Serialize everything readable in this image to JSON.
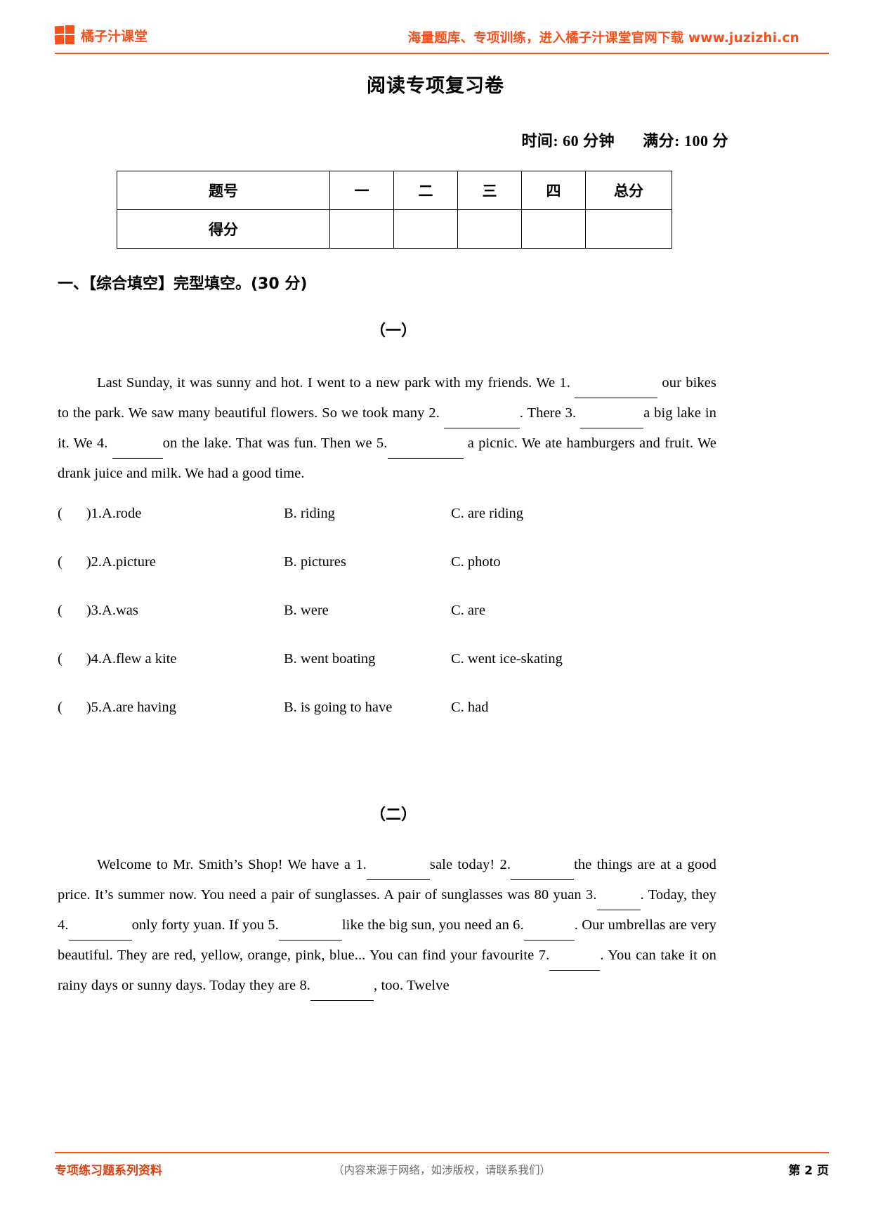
{
  "header": {
    "logo_text": "橘子汁课堂",
    "logo_icon": "four-squares-logo-icon",
    "promo_text": "海量题库、专项训练，进入橘子汁课堂官网下载 www.juzizhi.cn",
    "accent_color": "#F4511E"
  },
  "title": "阅读专项复习卷",
  "meta": {
    "time_label": "时间: 60 分钟",
    "score_label": "满分: 100 分"
  },
  "score_table": {
    "row1_label": "题号",
    "row2_label": "得分",
    "columns": [
      "一",
      "二",
      "三",
      "四",
      "总分"
    ],
    "row2_values": [
      "",
      "",
      "",
      "",
      ""
    ]
  },
  "section_one": {
    "heading": "一、【综合填空】完型填空。(30 分)",
    "part_one_marker": "（一）",
    "part_two_marker": "（二）",
    "passage_one": {
      "s1": "Last Sunday, it was sunny and hot. I went to a new park with my friends. We 1.",
      "s2": "our bikes to the park. We saw many beautiful flowers. So we took many 2.",
      "s3": ". There 3.",
      "s4": "a big lake in it. We 4.",
      "s5": "on the lake. That was fun. Then we 5.",
      "s6": "a picnic. We ate hamburgers and fruit. We drank juice and milk. We had a good time."
    },
    "questions": [
      {
        "num": "1.",
        "a": "A.rode",
        "b": "B. riding",
        "c": "C. are riding"
      },
      {
        "num": "2.",
        "a": "A.picture",
        "b": "B. pictures",
        "c": "C. photo"
      },
      {
        "num": "3.",
        "a": "A.was",
        "b": "B. were",
        "c": "C. are"
      },
      {
        "num": "4.",
        "a": "A.flew a kite",
        "b": "B. went boating",
        "c": "C. went ice-skating"
      },
      {
        "num": "5.",
        "a": "A.are having",
        "b": "B. is going to have",
        "c": "C. had"
      }
    ],
    "passage_two": {
      "s1": "Welcome to Mr. Smith’s Shop! We have a 1.",
      "s2": "sale today! 2.",
      "s3": "the things are at a good price. It’s summer now. You need a pair of sunglasses. A pair of sunglasses was 80 yuan 3.",
      "s4": ". Today, they 4.",
      "s5": "only forty yuan. If you 5.",
      "s6": "like the big sun, you need an 6.",
      "s7": ". Our umbrellas are very beautiful. They are red, yellow, orange, pink, blue... You can find your favourite 7.",
      "s8": ". You can take it on rainy days or sunny days. Today they are 8.",
      "s9": ",  too. Twelve"
    }
  },
  "footer": {
    "left": "专项练习题系列资料",
    "center": "（内容来源于网络，如涉版权，请联系我们）",
    "page": "第 2 页"
  }
}
